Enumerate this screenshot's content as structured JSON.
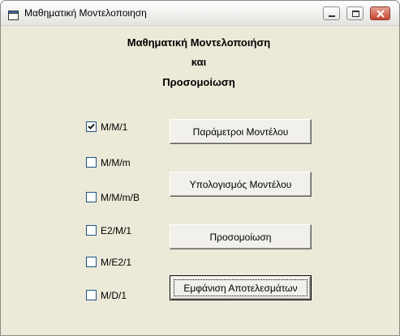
{
  "window": {
    "title": "Μαθηματική Μοντελοποιηση"
  },
  "header": {
    "line1": "Μαθηματική Μοντελοποιήση",
    "line2": "και",
    "line3": "Προσομοίωση"
  },
  "options": [
    {
      "label": "M/M/1",
      "checked": true
    },
    {
      "label": "M/M/m",
      "checked": false
    },
    {
      "label": "M/M/m/B",
      "checked": false
    },
    {
      "label": "E2/M/1",
      "checked": false
    },
    {
      "label": "M/E2/1",
      "checked": false
    },
    {
      "label": "M/D/1",
      "checked": false
    }
  ],
  "buttons": {
    "parameters": "Παράμετροι Μοντέλου",
    "compute": "Υπολογισμός Μοντέλου",
    "simulate": "Προσομοίωση",
    "results": "Εμφάνιση Αποτελεσμάτων"
  },
  "colors": {
    "window_bg": "#ece9d8",
    "close_button": "#c7452f"
  }
}
